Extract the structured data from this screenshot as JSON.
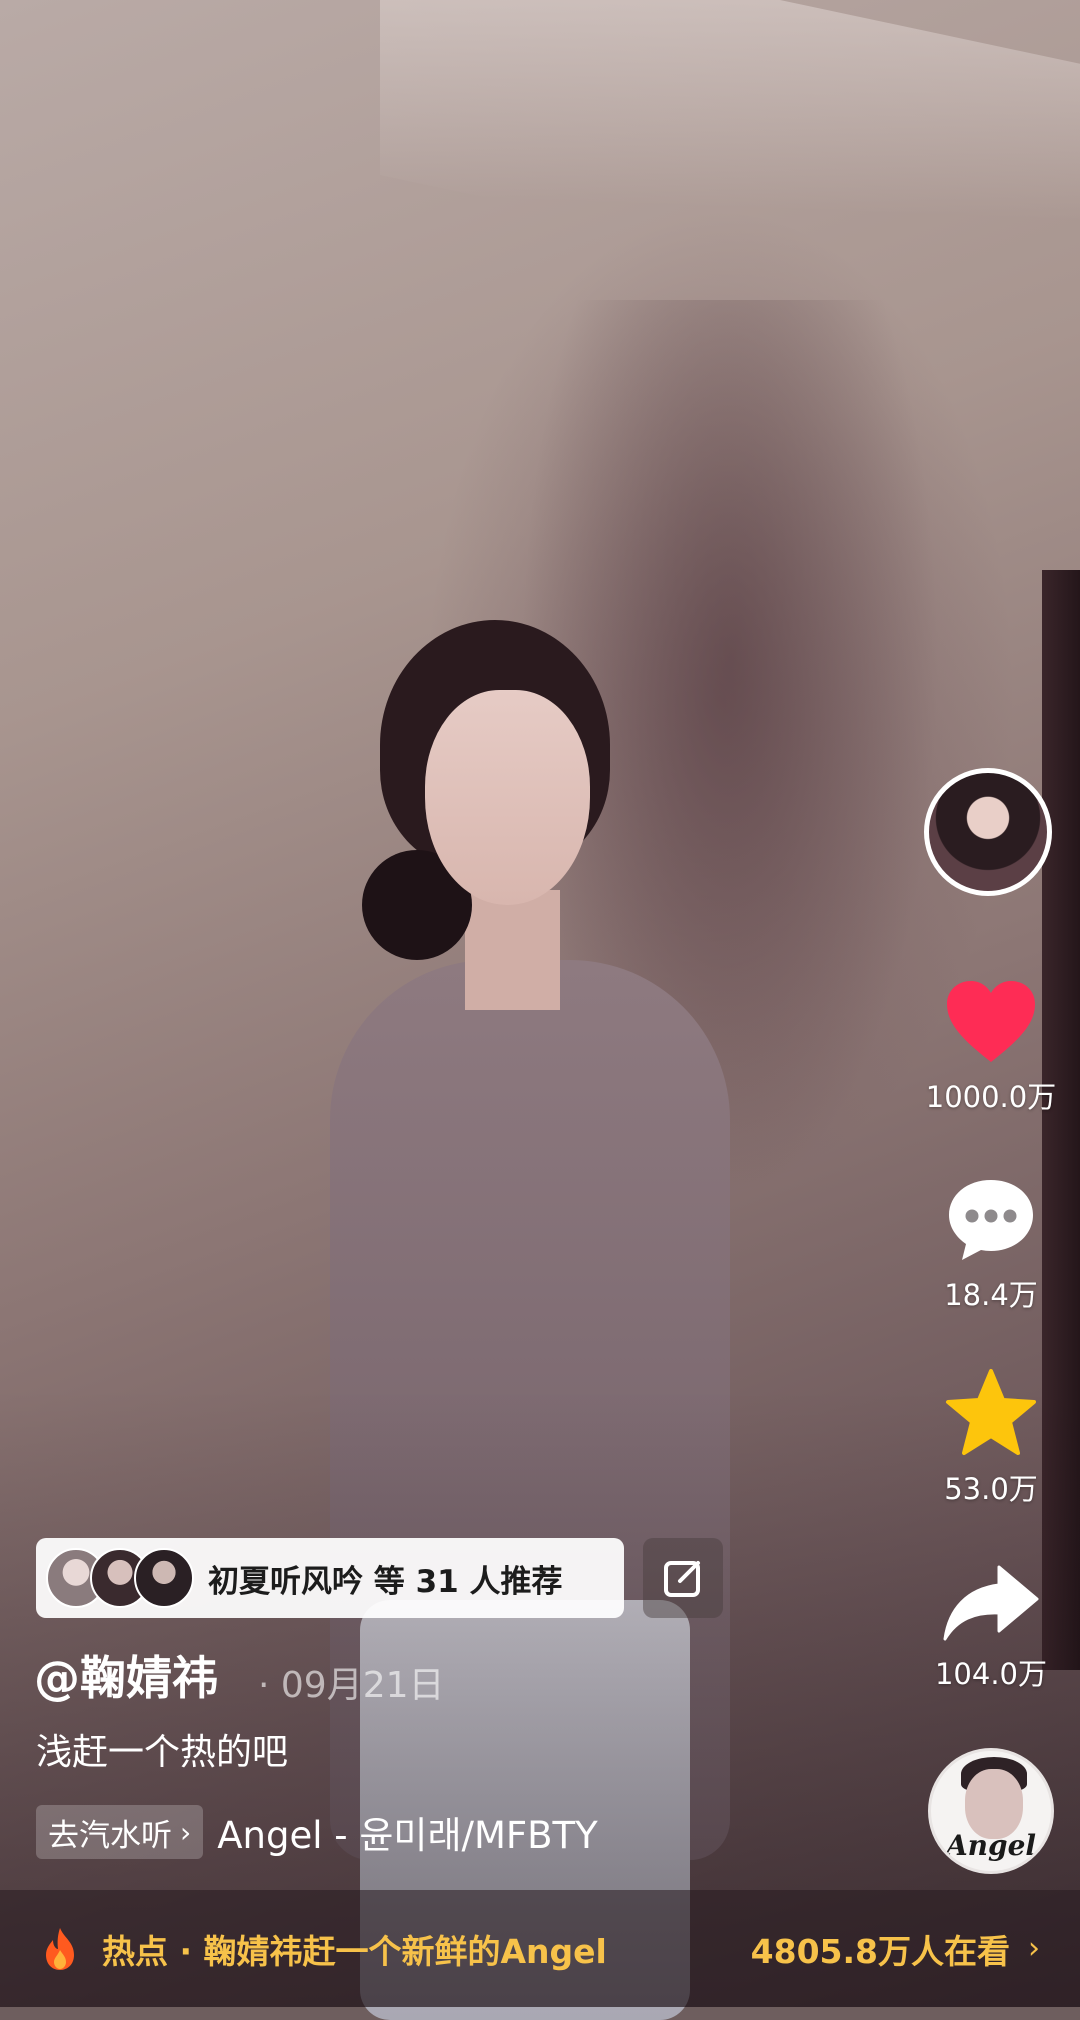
{
  "sidebar": {
    "like_count": "1000.0万",
    "comment_count": "18.4万",
    "favorite_count": "53.0万",
    "share_count": "104.0万",
    "music_disc_label": "Angel"
  },
  "recommend": {
    "text": "初夏听风吟 等 31 人推荐"
  },
  "post": {
    "author": "@鞠婧祎",
    "date": "· 09月21日",
    "description": "浅赶一个热的吧"
  },
  "music": {
    "go_qishui_label": "去汽水听",
    "song": "Angel - 윤미래/MFBTY"
  },
  "hot": {
    "text": "热点 · 鞠婧祎赶一个新鲜的Angel",
    "viewers": "4805.8万人在看"
  },
  "icons": {
    "like": "heart-icon",
    "comment": "comment-bubble-icon",
    "favorite": "star-icon",
    "share": "share-arrow-icon",
    "edit": "edit-icon",
    "hot": "fire-icon"
  },
  "colors": {
    "like": "#fe2c55",
    "favorite": "#fdc50c",
    "hot_text": "#f7c24a"
  }
}
